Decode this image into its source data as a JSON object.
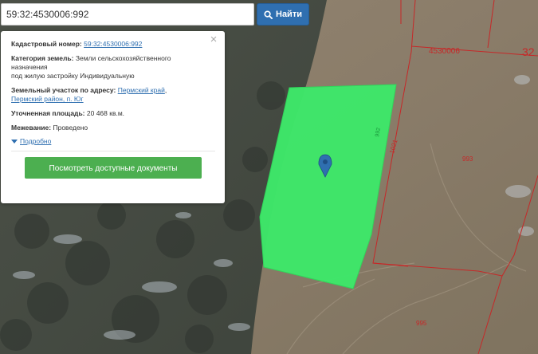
{
  "search": {
    "value": "59:32:4530006:992",
    "button_label": "Найти"
  },
  "popup": {
    "cadastral_label": "Кадастровый номер:",
    "cadastral_value": "59:32:4530006:992",
    "category_label": "Категория земель:",
    "category_value_1": "Земли сельскохозяйственного",
    "category_value_2": "назначения",
    "category_value_3": "под жилую застройку Индивидуальную",
    "address_label": "Земельный участок по адресу:",
    "address_link_1": "Пермский край",
    "address_sep": ",",
    "address_link_2": "Пермский район, п. Юг",
    "area_label": "Уточненная площадь:",
    "area_value": "20 468 кв.м.",
    "survey_label": "Межевание:",
    "survey_value": "Проведено",
    "more_label": "Подробно",
    "docs_button": "Посмотреть доступные документы"
  },
  "map_labels": {
    "quarter": "4530006",
    "district": "32",
    "plot_1021": "1021",
    "plot_993": "993",
    "plot_995": "995",
    "plot_992": "992"
  },
  "colors": {
    "parcel": "#3ee86a",
    "boundary": "#c62828",
    "button_blue": "#2f6fb0",
    "button_green": "#4caf50"
  }
}
